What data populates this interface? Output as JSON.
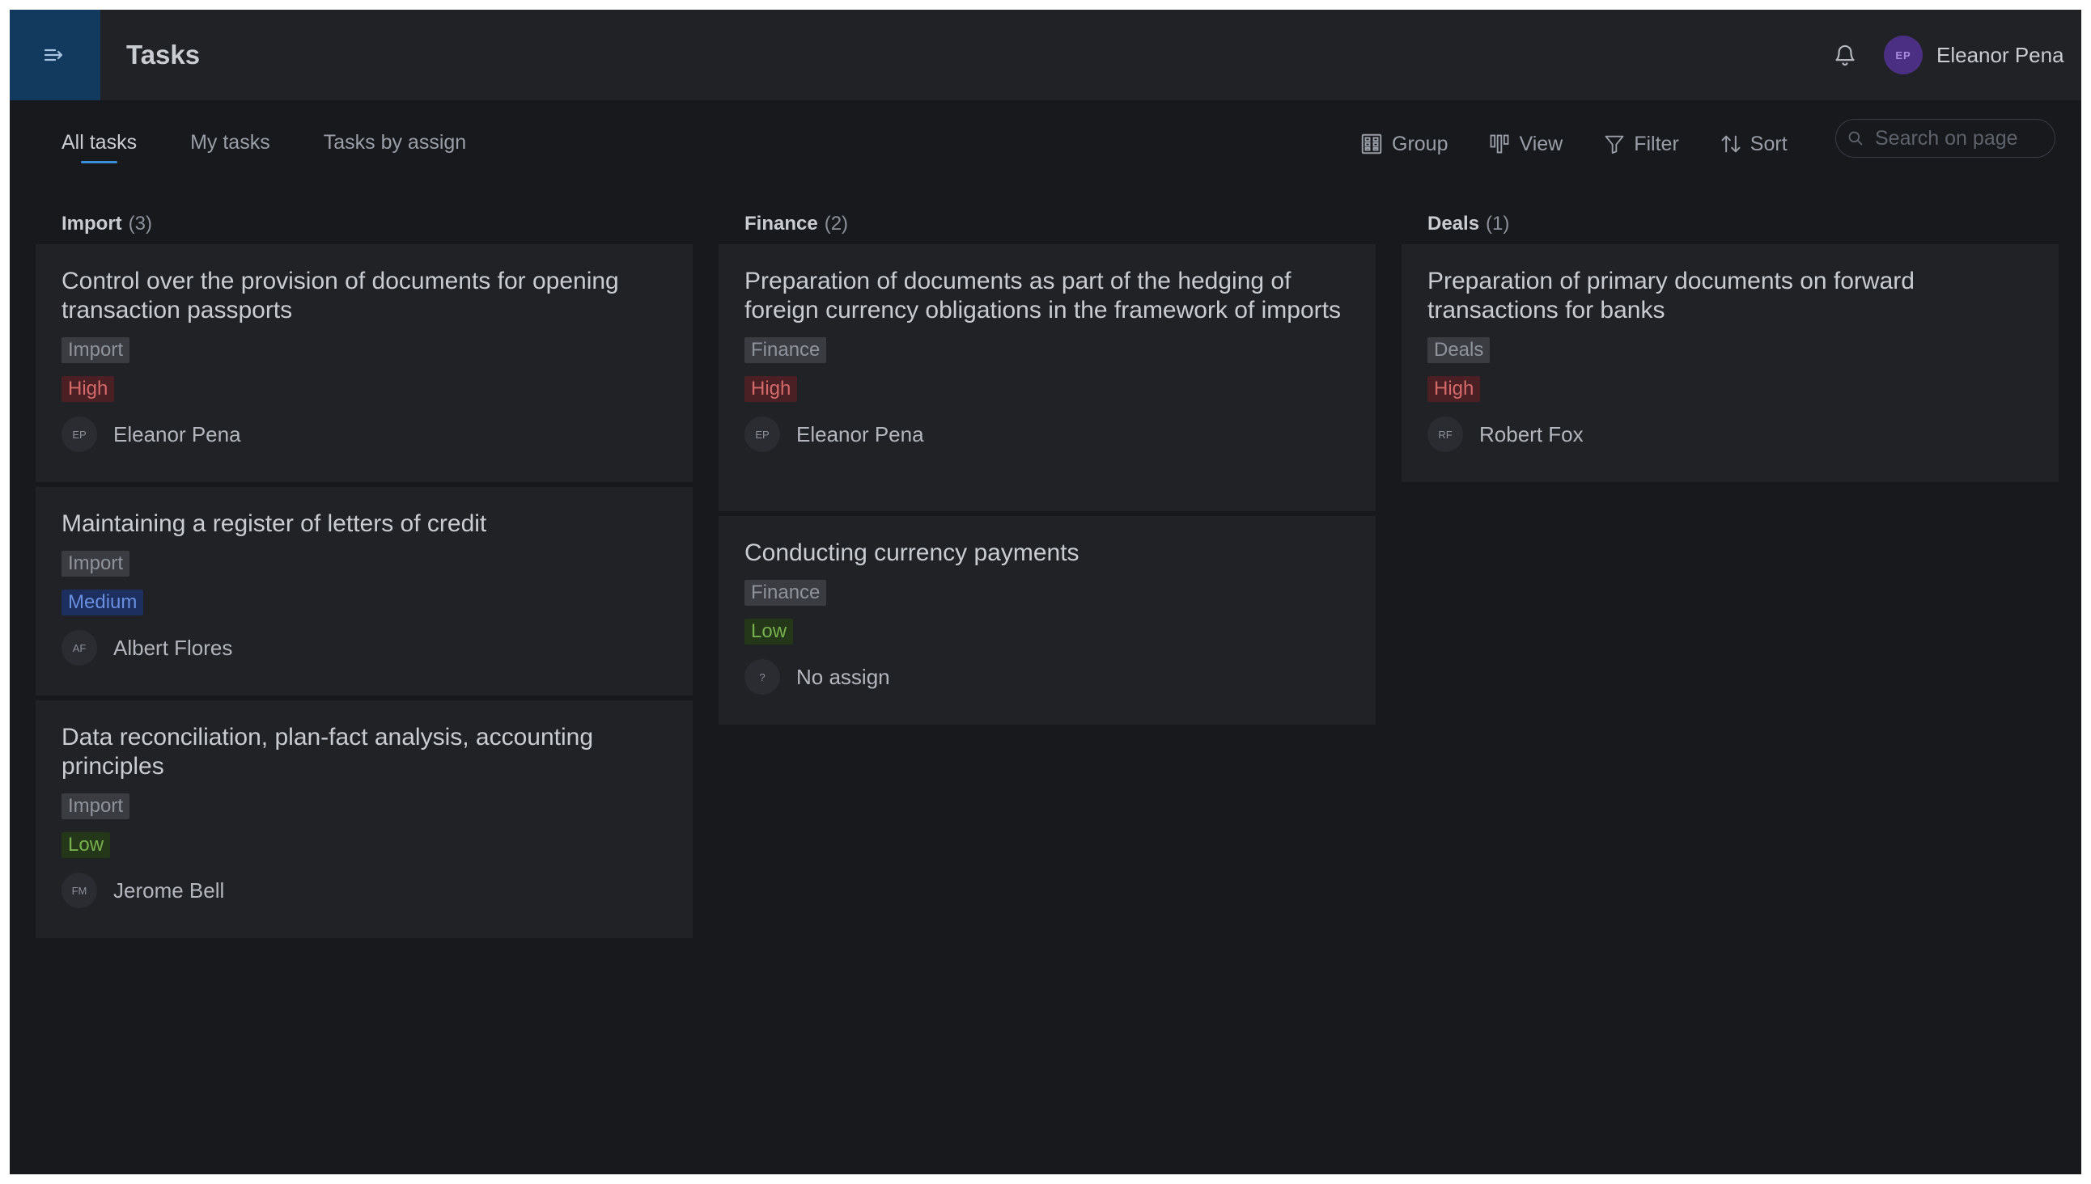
{
  "header": {
    "title": "Tasks",
    "user": {
      "initials": "EP",
      "name": "Eleanor Pena"
    },
    "icons": {
      "menu": "menu-arrow-icon",
      "notifications": "bell-icon"
    }
  },
  "tabs": [
    {
      "label": "All tasks",
      "active": true
    },
    {
      "label": "My tasks",
      "active": false
    },
    {
      "label": "Tasks by assign",
      "active": false
    }
  ],
  "tools": {
    "group": "Group",
    "view": "View",
    "filter": "Filter",
    "sort": "Sort"
  },
  "search": {
    "placeholder": "Search on page",
    "value": ""
  },
  "colors": {
    "accent": "#3a8fd9",
    "high": "#d56a6a",
    "medium": "#6a8fe0",
    "low": "#77b04d"
  },
  "columns": [
    {
      "name": "Import",
      "count": "(3)",
      "cards": [
        {
          "title": "Control over the provision of documents for opening transaction passports",
          "category": "Import",
          "priority": "High",
          "assignee_initials": "EP",
          "assignee": "Eleanor Pena"
        },
        {
          "title": "Maintaining a register of letters of credit",
          "category": "Import",
          "priority": "Medium",
          "assignee_initials": "AF",
          "assignee": "Albert Flores"
        },
        {
          "title": "Data reconciliation, plan-fact analysis, accounting principles",
          "category": "Import",
          "priority": "Low",
          "assignee_initials": "FM",
          "assignee": "Jerome Bell"
        }
      ]
    },
    {
      "name": "Finance",
      "count": "(2)",
      "cards": [
        {
          "title": "Preparation of documents as part of the hedging of foreign currency obligations in the framework of imports",
          "category": "Finance",
          "priority": "High",
          "assignee_initials": "EP",
          "assignee": "Eleanor Pena"
        },
        {
          "title": "Conducting currency payments",
          "category": "Finance",
          "priority": "Low",
          "assignee_initials": "?",
          "assignee": "No assign"
        }
      ]
    },
    {
      "name": "Deals",
      "count": "(1)",
      "cards": [
        {
          "title": "Preparation of primary documents on forward transactions for banks",
          "category": "Deals",
          "priority": "High",
          "assignee_initials": "RF",
          "assignee": "Robert Fox"
        }
      ]
    }
  ]
}
